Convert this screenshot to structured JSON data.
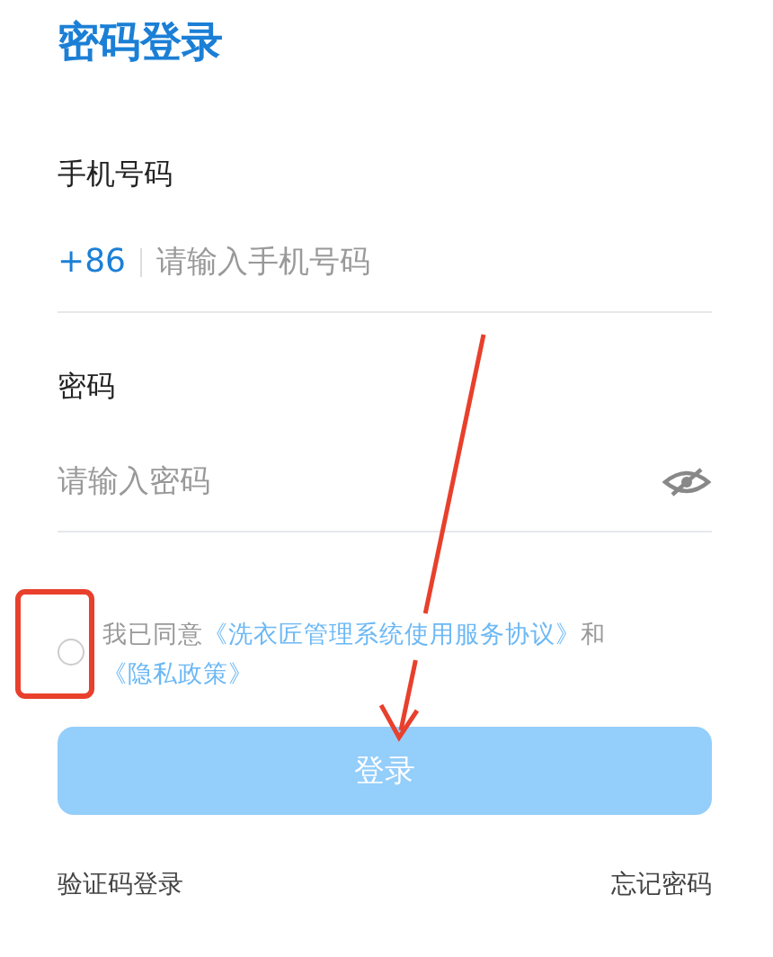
{
  "title": "密码登录",
  "phone": {
    "label": "手机号码",
    "country_code": "+86",
    "placeholder": "请输入手机号码"
  },
  "password": {
    "label": "密码",
    "placeholder": "请输入密码",
    "visible": false
  },
  "agreement": {
    "checked": false,
    "prefix": "我已同意",
    "terms_link": "《洗衣匠管理系统使用服务协议》",
    "joiner": "和",
    "privacy_link": "《隐私政策》"
  },
  "login_button": {
    "label": "登录",
    "disabled": true
  },
  "footer": {
    "left_link": "验证码登录",
    "right_link": "忘记密码"
  }
}
